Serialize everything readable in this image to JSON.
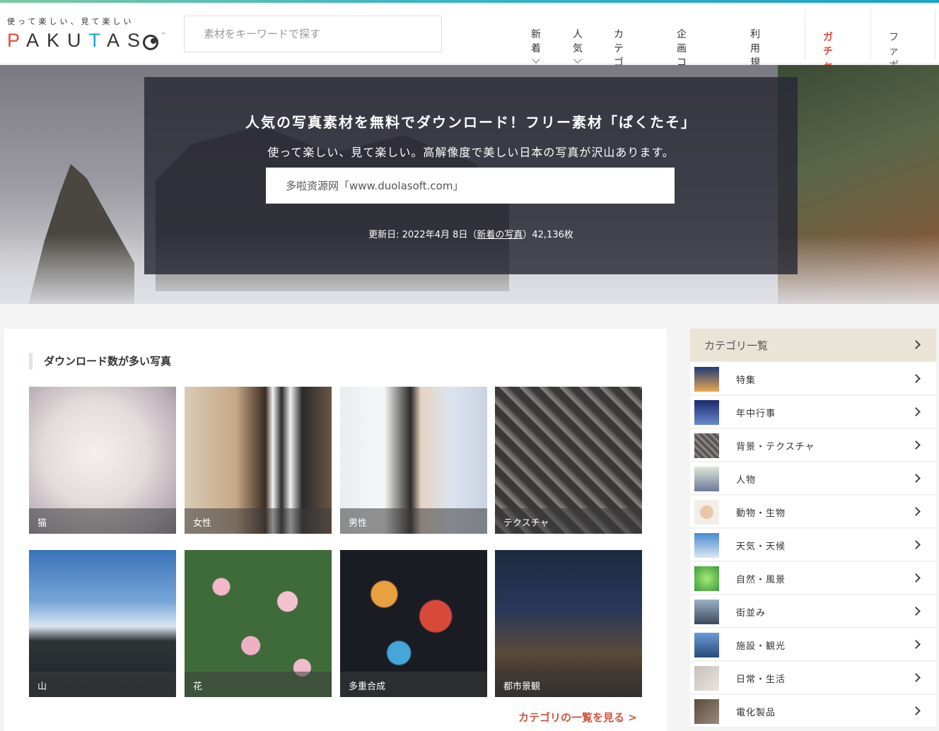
{
  "header": {
    "tagline": "使って楽しい、見て楽しい",
    "logo_word": "PAKUTAS",
    "logo_tm": "™",
    "search_placeholder": "素材をキーワードで探す",
    "nav": [
      "新着",
      "人気",
      "カテゴリ",
      "企画コラボ",
      "利用規約"
    ],
    "gacha": "ガチャ",
    "fav": "ファボ"
  },
  "hero": {
    "title": "人気の写真素材を無料でダウンロード！フリー素材「ぱくたそ」",
    "subtitle": "使って楽しい、見て楽しい。高解像度で美しい日本の写真が沢山あります。",
    "input_value": "多啦资源网「www.duolasoft.com」",
    "update_prefix": "更新日: 2022年4月 8日（",
    "update_link": "新着の写真",
    "update_suffix": "）42,136枚"
  },
  "main": {
    "section_title": "ダウンロード数が多い写真",
    "tiles": [
      "猫",
      "女性",
      "男性",
      "テクスチャ",
      "山",
      "花",
      "多重合成",
      "都市景観"
    ],
    "more_link": "カテゴリの一覧を見る >"
  },
  "sidebar": {
    "title": "カテゴリ一覧",
    "items": [
      "特集",
      "年中行事",
      "背景・テクスチャ",
      "人物",
      "動物・生物",
      "天気・天候",
      "自然・風景",
      "街並み",
      "施設・観光",
      "日常・生活",
      "電化製品"
    ]
  }
}
